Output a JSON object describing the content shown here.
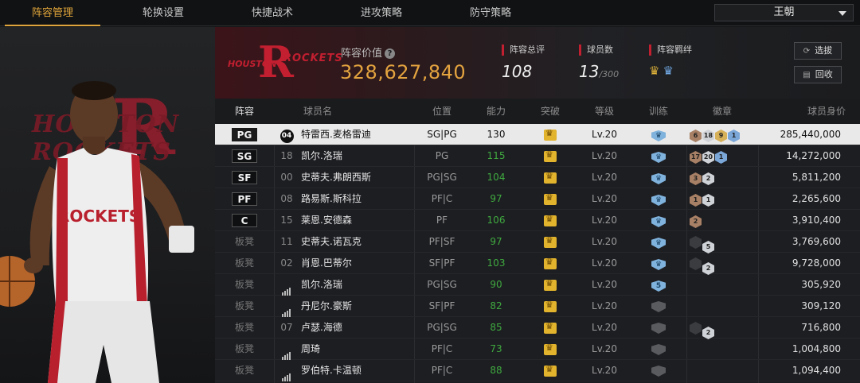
{
  "nav": {
    "tabs": [
      {
        "label": "阵容管理",
        "active": true
      },
      {
        "label": "轮换设置",
        "active": false
      },
      {
        "label": "快捷战术",
        "active": false
      },
      {
        "label": "进攻策略",
        "active": false
      },
      {
        "label": "防守策略",
        "active": false
      }
    ],
    "team_select": "王朝"
  },
  "art": {
    "logo_text": "HOUSTON ROCKETS",
    "logo_letter": "R"
  },
  "header": {
    "logo_small_text": "HOUSTON",
    "logo_text": "ROCKETS",
    "logo_letter": "R",
    "value_label": "阵容价值",
    "value": "328,627,840",
    "rating_label": "阵容总评",
    "rating": "108",
    "count_label": "球员数",
    "count": "13",
    "count_max": "/300",
    "bond_label": "阵容羁绊",
    "buttons": {
      "sign": "选拔",
      "recycle": "回收"
    }
  },
  "table": {
    "columns": [
      "阵容",
      "球员名",
      "位置",
      "能力",
      "突破",
      "等级",
      "训练",
      "徽章",
      "球员身价"
    ],
    "rows": [
      {
        "slot": "PG",
        "starter": true,
        "number": "04",
        "name": "特雷西.麦格雷迪",
        "position": "SG|PG",
        "ability": "130",
        "level": "Lv.20",
        "train": "crown",
        "badges": [
          [
            "6",
            "bronze"
          ],
          [
            "18",
            "silver"
          ],
          [
            "9",
            "gold"
          ],
          [
            "1",
            "blue"
          ]
        ],
        "salary": "285,440,000",
        "selected": true
      },
      {
        "slot": "SG",
        "starter": true,
        "number": "18",
        "name": "凯尔.洛瑞",
        "position": "PG",
        "ability": "115",
        "level": "Lv.20",
        "train": "crown",
        "badges": [
          [
            "17",
            "bronze"
          ],
          [
            "20",
            "silver"
          ],
          [
            "1",
            "blue"
          ]
        ],
        "salary": "14,272,000"
      },
      {
        "slot": "SF",
        "starter": true,
        "number": "00",
        "name": "史蒂夫.弗朗西斯",
        "position": "PG|SG",
        "ability": "104",
        "level": "Lv.20",
        "train": "crown",
        "badges": [
          [
            "3",
            "bronze"
          ],
          [
            "2",
            "silver"
          ]
        ],
        "salary": "5,811,200"
      },
      {
        "slot": "PF",
        "starter": true,
        "number": "08",
        "name": "路易斯.斯科拉",
        "position": "PF|C",
        "ability": "97",
        "level": "Lv.20",
        "train": "crown",
        "badges": [
          [
            "1",
            "bronze"
          ],
          [
            "1",
            "silver"
          ]
        ],
        "salary": "2,265,600"
      },
      {
        "slot": "C",
        "starter": true,
        "number": "15",
        "name": "莱恩.安德森",
        "position": "PF",
        "ability": "106",
        "level": "Lv.20",
        "train": "crown",
        "badges": [
          [
            "2",
            "bronze"
          ]
        ],
        "salary": "3,910,400"
      },
      {
        "slot": "板凳",
        "starter": false,
        "number": "11",
        "name": "史蒂夫.诺瓦克",
        "position": "PF|SF",
        "ability": "97",
        "level": "Lv.20",
        "train": "crown",
        "badges": [
          [
            "",
            "dark"
          ],
          [
            "5",
            "silver"
          ]
        ],
        "salary": "3,769,600"
      },
      {
        "slot": "板凳",
        "starter": false,
        "number": "02",
        "name": "肖恩.巴蒂尔",
        "position": "SF|PF",
        "ability": "103",
        "level": "Lv.20",
        "train": "crown",
        "badges": [
          [
            "",
            "dark"
          ],
          [
            "2",
            "silver"
          ]
        ],
        "salary": "9,728,000"
      },
      {
        "slot": "板凳",
        "starter": false,
        "number": "bars",
        "name": "凯尔.洛瑞",
        "position": "PG|SG",
        "ability": "90",
        "level": "Lv.20",
        "train": "5",
        "badges": [],
        "salary": "305,920"
      },
      {
        "slot": "板凳",
        "starter": false,
        "number": "bars",
        "name": "丹尼尔.豪斯",
        "position": "SF|PF",
        "ability": "82",
        "level": "Lv.20",
        "train": "grey",
        "badges": [],
        "salary": "309,120"
      },
      {
        "slot": "板凳",
        "starter": false,
        "number": "07",
        "name": "卢瑟.海德",
        "position": "PG|SG",
        "ability": "85",
        "level": "Lv.20",
        "train": "grey",
        "badges": [
          [
            "",
            "dark"
          ],
          [
            "2",
            "silver"
          ]
        ],
        "salary": "716,800"
      },
      {
        "slot": "板凳",
        "starter": false,
        "number": "bars",
        "name": "周琦",
        "position": "PF|C",
        "ability": "73",
        "level": "Lv.20",
        "train": "grey",
        "badges": [],
        "salary": "1,004,800"
      },
      {
        "slot": "板凳",
        "starter": false,
        "number": "bars",
        "name": "罗伯特.卡温顿",
        "position": "PF|C",
        "ability": "88",
        "level": "Lv.20",
        "train": "grey",
        "badges": [],
        "salary": "1,094,400"
      }
    ]
  },
  "colors": {
    "accent": "#e0a53a",
    "team_red": "#c21f30",
    "ability_green": "#3fa93f"
  }
}
